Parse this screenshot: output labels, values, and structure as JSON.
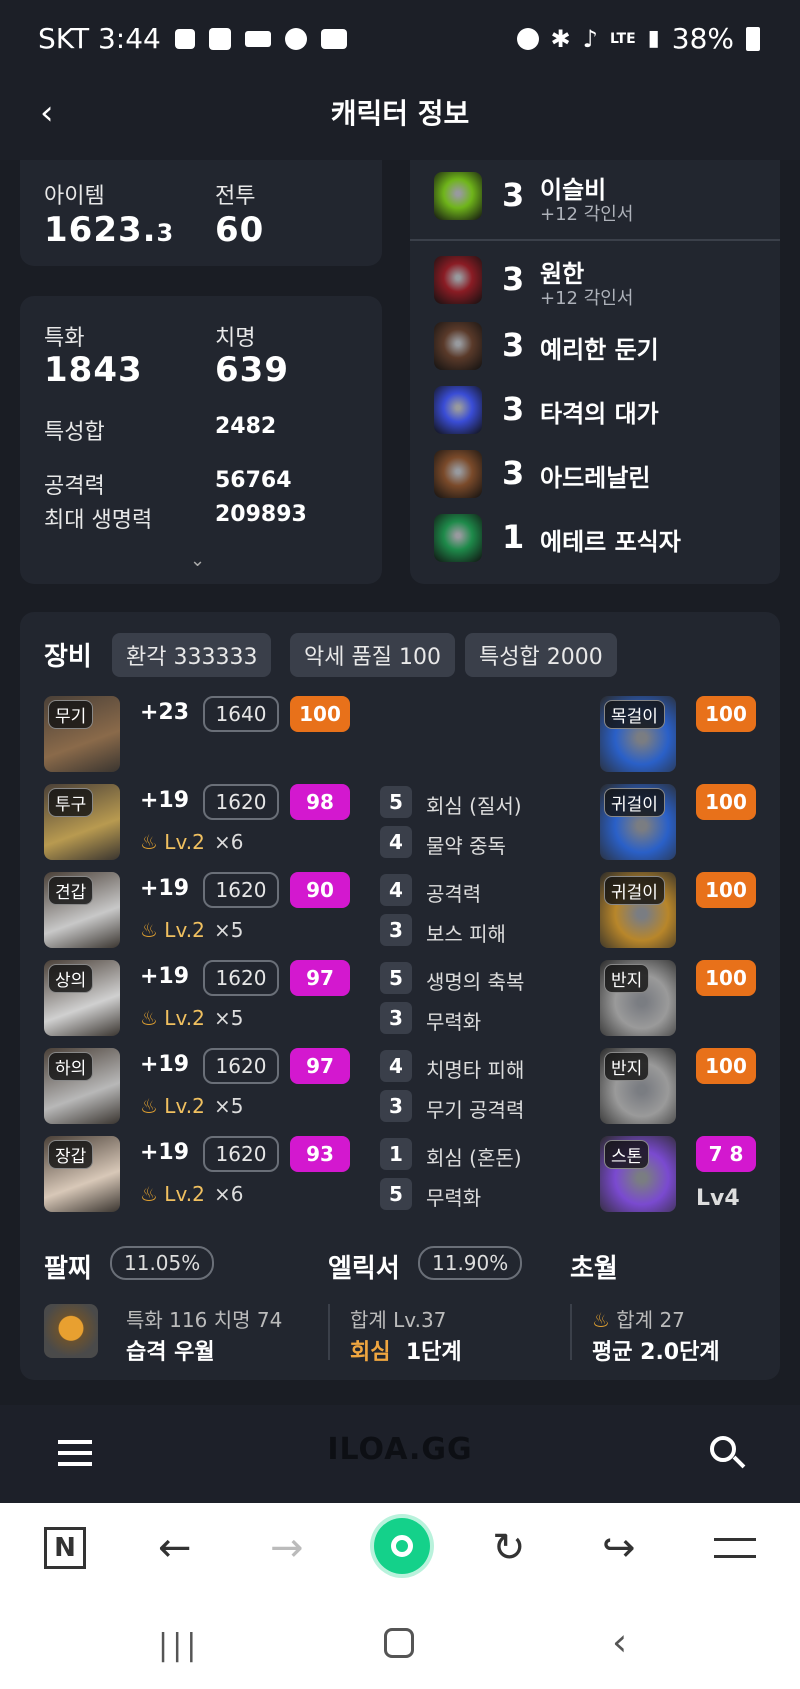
{
  "status": {
    "carrier_time": "SKT 3:44",
    "battery": "38%",
    "network": "LTE"
  },
  "header": {
    "title": "캐릭터 정보"
  },
  "stats_top": {
    "item_label": "아이템",
    "item_value": "1623.",
    "item_decimal": "3",
    "battle_label": "전투",
    "battle_value": "60"
  },
  "stats": {
    "spec_label": "특화",
    "spec_value": "1843",
    "crit_label": "치명",
    "crit_value": "639",
    "sum_label": "특성합",
    "sum_value": "2482",
    "atk_label": "공격력",
    "atk_value": "56764",
    "hp_label": "최대 생명력",
    "hp_value": "209893"
  },
  "engravings": [
    {
      "level": "3",
      "name": "이슬비",
      "sub": "+12 각인서",
      "color": "#6fb51a"
    },
    {
      "level": "3",
      "name": "원한",
      "sub": "+12 각인서",
      "color": "#8a1c24"
    },
    {
      "level": "3",
      "name": "예리한 둔기",
      "sub": "",
      "color": "#5a3a2a"
    },
    {
      "level": "3",
      "name": "타격의 대가",
      "sub": "",
      "color": "#3a4dd6"
    },
    {
      "level": "3",
      "name": "아드레날린",
      "sub": "",
      "color": "#7a4a2a"
    },
    {
      "level": "1",
      "name": "에테르 포식자",
      "sub": "",
      "color": "#1e8a4a"
    }
  ],
  "equipment": {
    "title": "장비",
    "chips": [
      "환각 333333",
      "악세 품질 100",
      "특성합 2000"
    ],
    "armor": [
      {
        "slot": "무기",
        "enh": "+23",
        "lvl": "1640",
        "quality": "100",
        "qtype": "o",
        "elixir": "",
        "mult": ""
      },
      {
        "slot": "투구",
        "enh": "+19",
        "lvl": "1620",
        "quality": "98",
        "qtype": "m",
        "elixir": "Lv.2",
        "mult": "×6"
      },
      {
        "slot": "견갑",
        "enh": "+19",
        "lvl": "1620",
        "quality": "90",
        "qtype": "m",
        "elixir": "Lv.2",
        "mult": "×5"
      },
      {
        "slot": "상의",
        "enh": "+19",
        "lvl": "1620",
        "quality": "97",
        "qtype": "m",
        "elixir": "Lv.2",
        "mult": "×5"
      },
      {
        "slot": "하의",
        "enh": "+19",
        "lvl": "1620",
        "quality": "97",
        "qtype": "m",
        "elixir": "Lv.2",
        "mult": "×5"
      },
      {
        "slot": "장갑",
        "enh": "+19",
        "lvl": "1620",
        "quality": "93",
        "qtype": "m",
        "elixir": "Lv.2",
        "mult": "×6"
      }
    ],
    "effects": [
      [],
      [
        {
          "n": "5",
          "t": "회심 (질서)"
        },
        {
          "n": "4",
          "t": "물약 중독"
        }
      ],
      [
        {
          "n": "4",
          "t": "공격력"
        },
        {
          "n": "3",
          "t": "보스 피해"
        }
      ],
      [
        {
          "n": "5",
          "t": "생명의 축복"
        },
        {
          "n": "3",
          "t": "무력화"
        }
      ],
      [
        {
          "n": "4",
          "t": "치명타 피해"
        },
        {
          "n": "3",
          "t": "무기 공격력"
        }
      ],
      [
        {
          "n": "1",
          "t": "회심 (혼돈)"
        },
        {
          "n": "5",
          "t": "무력화"
        }
      ]
    ],
    "accessories": [
      {
        "slot": "목걸이",
        "quality": "100",
        "qtype": "o"
      },
      {
        "slot": "귀걸이",
        "quality": "100",
        "qtype": "o"
      },
      {
        "slot": "귀걸이",
        "quality": "100",
        "qtype": "o"
      },
      {
        "slot": "반지",
        "quality": "100",
        "qtype": "o"
      },
      {
        "slot": "반지",
        "quality": "100",
        "qtype": "o"
      },
      {
        "slot": "스톤",
        "quality": "7 8",
        "qtype": "m",
        "extra": "Lv4"
      }
    ]
  },
  "bracelet": {
    "title": "팔찌",
    "pct": "11.05%",
    "line1": "특화 116  치명 74",
    "line2": "습격  우월"
  },
  "elixir": {
    "title": "엘릭서",
    "pct": "11.90%",
    "line1": "합계 Lv.37",
    "line2_a": "회심",
    "line2_b": "1단계"
  },
  "transcend": {
    "title": "초월",
    "line1": "합계 27",
    "line2": "평균 2.0단계"
  },
  "site": {
    "logo": "ILOA.GG"
  },
  "colors": {
    "orange": "#e8711a",
    "magenta": "#d318cf",
    "bg": "#1a1d24",
    "card": "#22262f"
  }
}
